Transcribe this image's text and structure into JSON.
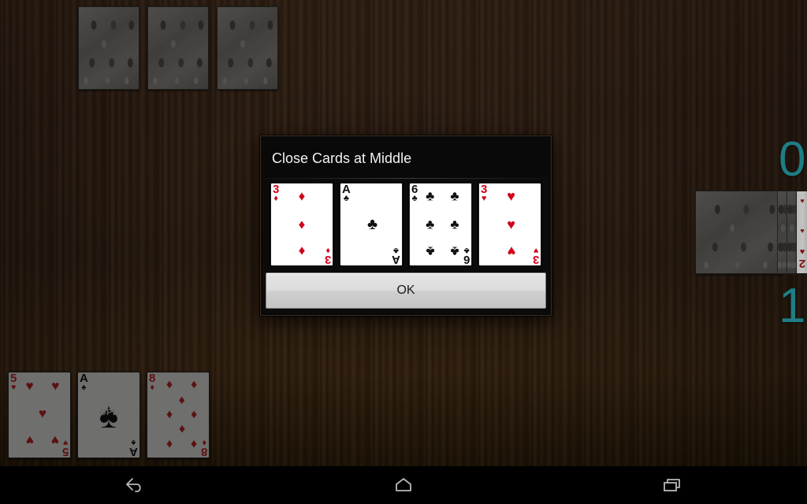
{
  "app": {
    "background": "wood-table",
    "accent_color": "#1e7d85",
    "felt_color": "#2c1d12"
  },
  "dialog": {
    "title": "Close Cards at Middle",
    "ok_label": "OK",
    "cards": [
      {
        "rank": "3",
        "suit": "diamonds",
        "suit_glyph": "♦",
        "color": "red",
        "pip_count": 3
      },
      {
        "rank": "A",
        "suit": "clubs",
        "suit_glyph": "♣",
        "color": "black",
        "pip_count": 1
      },
      {
        "rank": "6",
        "suit": "clubs",
        "suit_glyph": "♣",
        "color": "black",
        "pip_count": 6
      },
      {
        "rank": "3",
        "suit": "hearts",
        "suit_glyph": "♥",
        "color": "red",
        "pip_count": 3
      }
    ]
  },
  "top_pile": {
    "label": "opponent-hand",
    "card_count": 3,
    "face_down": true
  },
  "bottom_hand": {
    "label": "player-hand",
    "cards": [
      {
        "rank": "5",
        "suit": "hearts",
        "suit_glyph": "♥",
        "color": "red",
        "pip_count": 5,
        "dimmed": true
      },
      {
        "rank": "A",
        "suit": "spades",
        "suit_glyph": "♠",
        "color": "black",
        "pip_count": 1,
        "dimmed": true,
        "watermark": "GPL"
      },
      {
        "rank": "8",
        "suit": "diamonds",
        "suit_glyph": "♦",
        "color": "red",
        "pip_count": 8,
        "dimmed": true
      }
    ]
  },
  "stock_pile": {
    "label": "deck-stack",
    "face_down_count": 5,
    "edge_card": {
      "rank": "2",
      "suit": "hearts",
      "suit_glyph": "♥",
      "color": "red"
    }
  },
  "scores": {
    "top_value": "0",
    "bottom_value": "1"
  },
  "navbar": {
    "back_label": "Back",
    "home_label": "Home",
    "recents_label": "Recent apps"
  }
}
